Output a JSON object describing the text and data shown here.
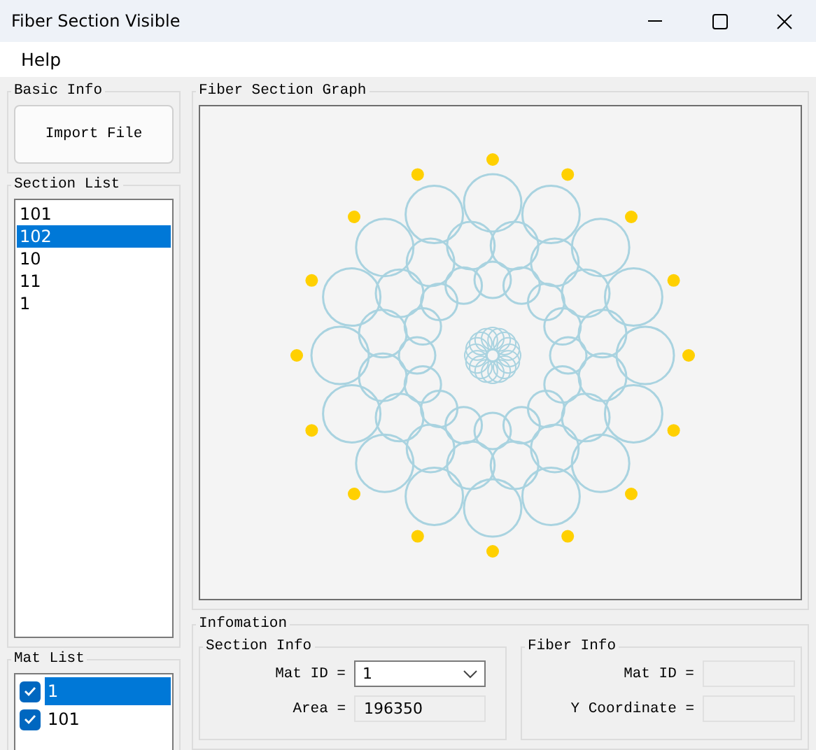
{
  "window": {
    "title": "Fiber Section Visible"
  },
  "menu": [
    {
      "label": "Help"
    }
  ],
  "basic_info": {
    "title": "Basic Info",
    "import_button": "Import File"
  },
  "section_list": {
    "title": "Section List",
    "items": [
      {
        "label": "101",
        "selected": false
      },
      {
        "label": "102",
        "selected": true
      },
      {
        "label": "10",
        "selected": false
      },
      {
        "label": "11",
        "selected": false
      },
      {
        "label": "1",
        "selected": false
      }
    ]
  },
  "mat_list": {
    "title": "Mat List",
    "items": [
      {
        "label": "1",
        "checked": true,
        "selected": true
      },
      {
        "label": "101",
        "checked": true,
        "selected": false
      }
    ]
  },
  "graph": {
    "title": "Fiber Section Graph"
  },
  "information": {
    "title": "Infomation",
    "section_info": {
      "title": "Section Info",
      "fields": [
        {
          "label": "Mat ID =",
          "value": "1",
          "kind": "dropdown"
        },
        {
          "label": "Area =",
          "value": "196350",
          "kind": "readonly"
        }
      ]
    },
    "fiber_info": {
      "title": "Fiber Info",
      "fields": [
        {
          "label": "Mat ID =",
          "kind": "readonly"
        },
        {
          "label": "Y Coordinate =",
          "kind": "readonly"
        }
      ]
    }
  }
}
